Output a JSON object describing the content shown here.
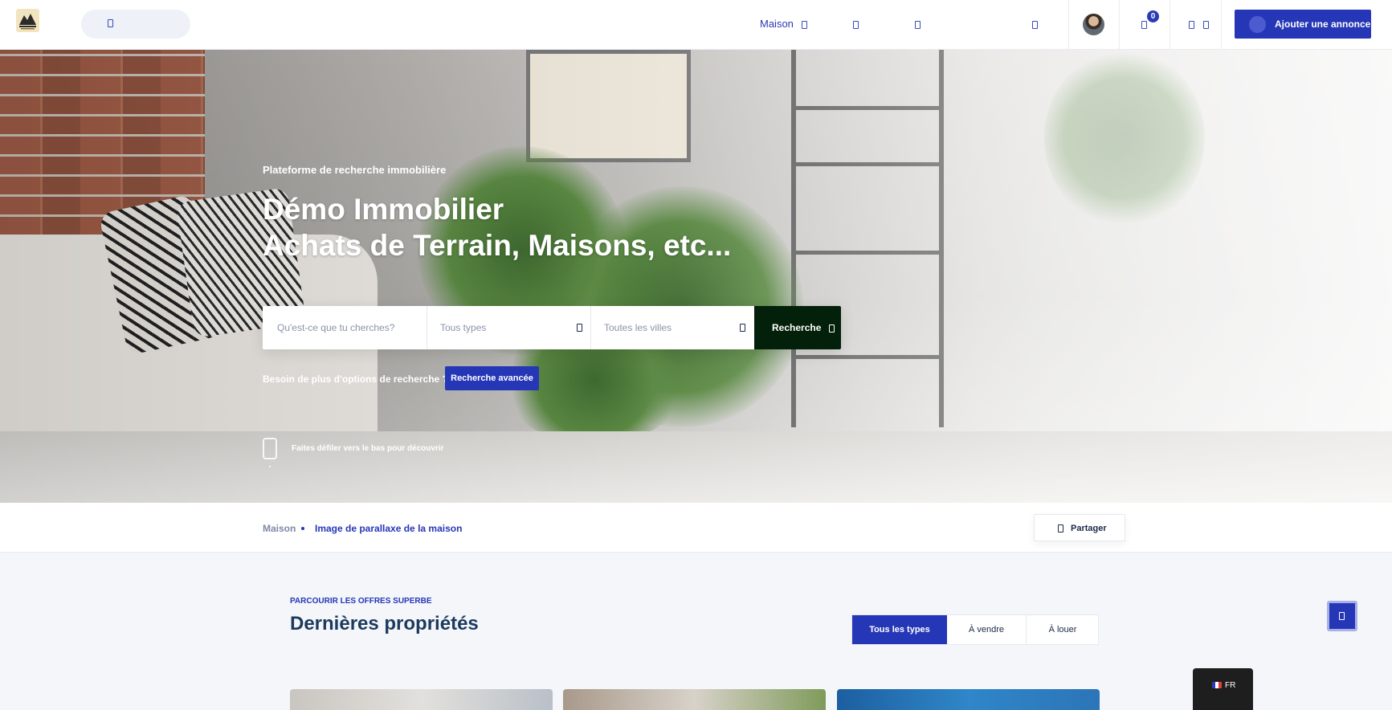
{
  "header": {
    "logo_alt": "logo",
    "nav": [
      {
        "label": "Maison",
        "icon": "chevron-down-icon"
      },
      {
        "label": "",
        "icon": "chevron-down-icon"
      },
      {
        "label": "",
        "icon": "chevron-down-icon"
      },
      {
        "label": "",
        "icon": "chevron-down-icon"
      }
    ],
    "cart_count": "0",
    "add_listing_label": "Ajouter une annonce"
  },
  "hero": {
    "kicker": "Plateforme de recherche immobilière",
    "title_line1": "Démo Immobilier",
    "title_line2": "Achats de Terrain, Maisons, etc...",
    "search": {
      "keyword_placeholder": "Qu'est-ce que tu cherches?",
      "type_value": "Tous types",
      "city_value": "Toutes les villes",
      "submit_label": "Recherche"
    },
    "advanced_question": "Besoin de plus d'options de recherche ?",
    "advanced_label": "Recherche avancée",
    "scroll_hint": "Faites défiler vers le bas pour découvrir"
  },
  "breadcrumb": {
    "home": "Maison",
    "current": "Image de parallaxe de la maison",
    "share_label": "Partager"
  },
  "listings": {
    "kicker": "PARCOURIR LES OFFRES SUPERBE",
    "title": "Dernières propriétés",
    "filters": [
      "Tous les types",
      "À vendre",
      "À louer"
    ],
    "active_filter": "Tous les types"
  },
  "language": {
    "code": "FR"
  },
  "colors": {
    "accent": "#2537b6",
    "search_button": "#02200a",
    "title": "#1c3a5e"
  }
}
